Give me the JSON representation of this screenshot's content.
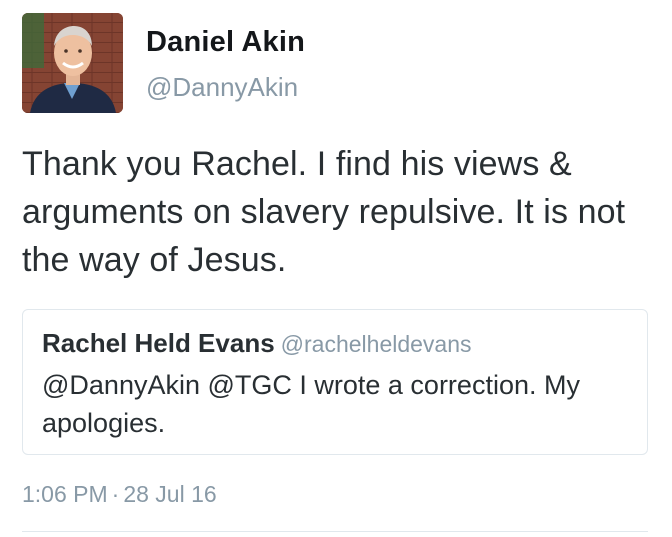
{
  "author": {
    "name": "Daniel Akin",
    "handle": "@DannyAkin",
    "avatar_icon": "profile-photo"
  },
  "tweet": {
    "text": "Thank you Rachel. I find his views & arguments on slavery repulsive. It is not the way of Jesus."
  },
  "quoted_tweet": {
    "author_name": "Rachel Held Evans",
    "author_handle": "@rachelheldevans",
    "text": "@DannyAkin @TGC I wrote a correction. My apologies."
  },
  "meta": {
    "time": "1:06 PM",
    "separator": "·",
    "date": "28 Jul 16"
  },
  "colors": {
    "primary_text": "#292f33",
    "secondary_text": "#8899a6",
    "border": "#e1e8ed"
  }
}
